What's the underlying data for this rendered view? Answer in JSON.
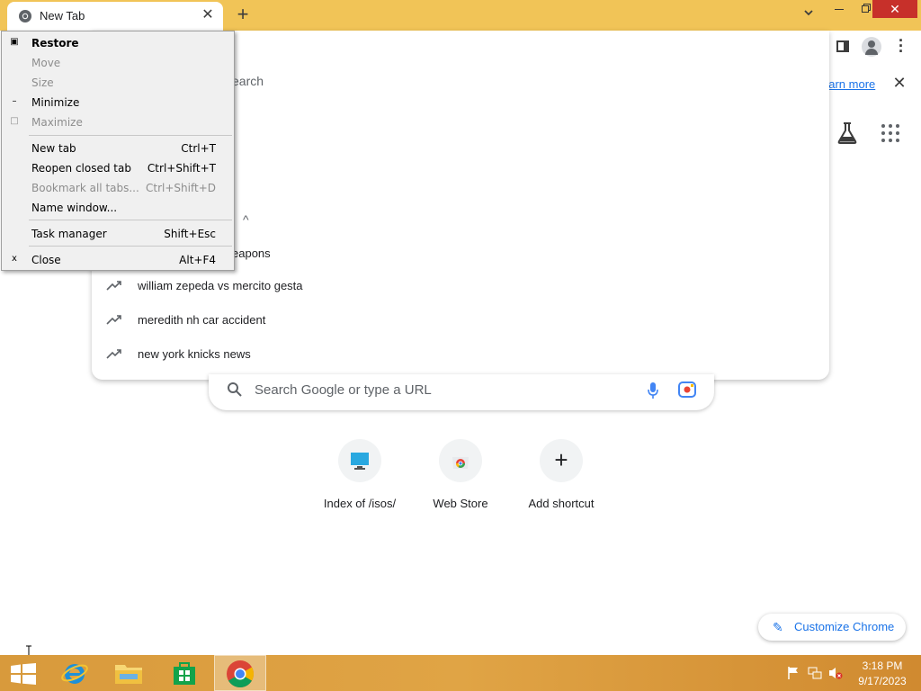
{
  "window": {
    "tab_title": "New Tab",
    "tab_close": "✕",
    "new_tab": "+",
    "tab_search": "⌄",
    "close_glyph": "✕"
  },
  "infobar": {
    "learn_more": "earn more",
    "close_glyph": "✕"
  },
  "suggestions": {
    "partial_search": "earch",
    "caret": "^",
    "partial_item": "eapons",
    "items": [
      {
        "text": "william zepeda vs mercito gesta"
      },
      {
        "text": "meredith nh car accident"
      },
      {
        "text": "new york knicks news"
      }
    ]
  },
  "search": {
    "placeholder": "Search Google or type a URL"
  },
  "shortcuts": [
    {
      "label": "Index of /isos/",
      "icon": "monitor-icon"
    },
    {
      "label": "Web Store",
      "icon": "webstore-icon"
    },
    {
      "label": "Add shortcut",
      "icon": "plus-icon"
    }
  ],
  "add_glyph": "+",
  "customize": {
    "label": "Customize Chrome",
    "icon": "✎"
  },
  "system_menu": {
    "items": [
      {
        "label": "Restore",
        "shortcut": "",
        "icon": "▣",
        "disabled": false,
        "bold": true
      },
      {
        "label": "Move",
        "shortcut": "",
        "icon": "",
        "disabled": true,
        "bold": false
      },
      {
        "label": "Size",
        "shortcut": "",
        "icon": "",
        "disabled": true,
        "bold": false
      },
      {
        "label": "Minimize",
        "shortcut": "",
        "icon": "–",
        "disabled": false,
        "bold": false
      },
      {
        "label": "Maximize",
        "shortcut": "",
        "icon": "□",
        "disabled": true,
        "bold": false
      },
      {
        "label": "New tab",
        "shortcut": "Ctrl+T",
        "icon": "",
        "disabled": false,
        "bold": false
      },
      {
        "label": "Reopen closed tab",
        "shortcut": "Ctrl+Shift+T",
        "icon": "",
        "disabled": false,
        "bold": false
      },
      {
        "label": "Bookmark all tabs...",
        "shortcut": "Ctrl+Shift+D",
        "icon": "",
        "disabled": true,
        "bold": false
      },
      {
        "label": "Name window...",
        "shortcut": "",
        "icon": "",
        "disabled": false,
        "bold": false
      },
      {
        "label": "Task manager",
        "shortcut": "Shift+Esc",
        "icon": "",
        "disabled": false,
        "bold": false
      },
      {
        "label": "Close",
        "shortcut": "Alt+F4",
        "icon": "x",
        "disabled": false,
        "bold": false
      }
    ]
  },
  "taskbar": {
    "time": "3:18 PM",
    "date": "9/17/2023"
  },
  "colors": {
    "titlebar": "#f1c457",
    "accent": "#1a73e8",
    "taskbar": "#e0a445",
    "close_button": "#c7302a"
  }
}
